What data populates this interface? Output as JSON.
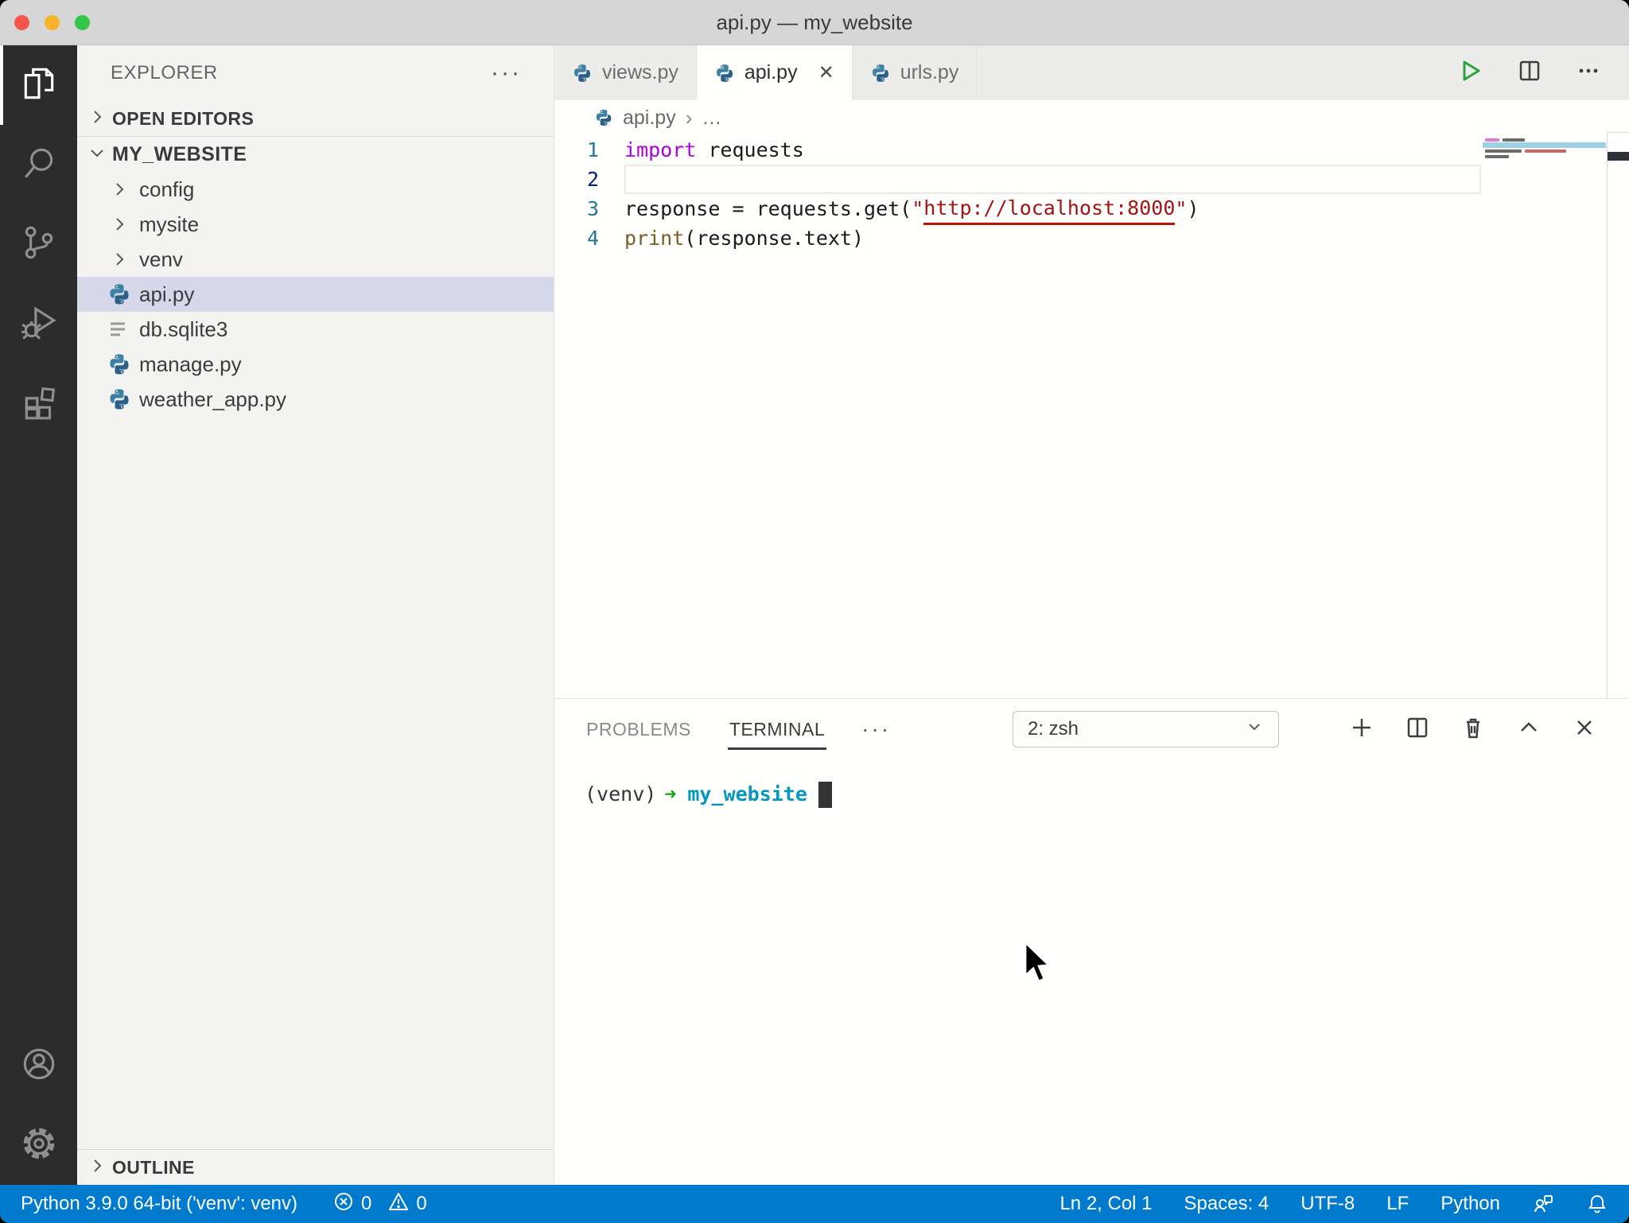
{
  "window": {
    "title": "api.py — my_website"
  },
  "activity_bar": {
    "items": [
      {
        "name": "explorer",
        "active": true
      },
      {
        "name": "search",
        "active": false
      },
      {
        "name": "source-control",
        "active": false
      },
      {
        "name": "run-and-debug",
        "active": false
      },
      {
        "name": "extensions",
        "active": false
      },
      {
        "name": "accounts",
        "active": false
      },
      {
        "name": "settings",
        "active": false
      }
    ]
  },
  "explorer": {
    "title": "EXPLORER",
    "more_label": "···",
    "open_editors": "OPEN EDITORS",
    "root": "MY_WEBSITE",
    "outline": "OUTLINE",
    "files": [
      {
        "name": "config",
        "kind": "folder"
      },
      {
        "name": "mysite",
        "kind": "folder"
      },
      {
        "name": "venv",
        "kind": "folder"
      },
      {
        "name": "api.py",
        "kind": "python",
        "selected": true
      },
      {
        "name": "db.sqlite3",
        "kind": "file"
      },
      {
        "name": "manage.py",
        "kind": "python"
      },
      {
        "name": "weather_app.py",
        "kind": "python"
      }
    ]
  },
  "tabs": [
    {
      "label": "views.py",
      "active": false
    },
    {
      "label": "api.py",
      "active": true,
      "close_glyph": "✕"
    },
    {
      "label": "urls.py",
      "active": false
    }
  ],
  "breadcrumb": {
    "file": "api.py",
    "separator": "›",
    "ellipsis": "…"
  },
  "code": {
    "current_line": "2",
    "line_numbers": [
      "1",
      "2",
      "3",
      "4"
    ],
    "line1": {
      "keyword": "import",
      "rest": " requests"
    },
    "line3": {
      "pre": "response = requests.get(",
      "quote_open": "\"",
      "url": "http://localhost:8000",
      "quote_close": "\"",
      "post": ")"
    },
    "line4": {
      "builtin": "print",
      "rest": "(response.text)"
    }
  },
  "panel": {
    "problems_tab": "PROBLEMS",
    "terminal_tab": "TERMINAL",
    "more_label": "···",
    "shell_selected": "2: zsh"
  },
  "terminal": {
    "prompt_env": "(venv)",
    "prompt_arrow": "➜",
    "prompt_path": "my_website"
  },
  "status_bar": {
    "interpreter": "Python 3.9.0 64-bit ('venv': venv)",
    "errors": "0",
    "warnings": "0",
    "line_col": "Ln 2, Col 1",
    "indent": "Spaces: 4",
    "encoding": "UTF-8",
    "eol": "LF",
    "language": "Python"
  },
  "colors": {
    "status_bar": "#007acc",
    "activity_bar": "#2c2c2c",
    "selection": "#d4d8e9",
    "keyword": "#af00db",
    "string": "#a31515",
    "builtin": "#795e26",
    "terminal_path": "#0598bc",
    "prompt_arrow_green": "#13a10e",
    "run_button_green": "#2aa341"
  }
}
